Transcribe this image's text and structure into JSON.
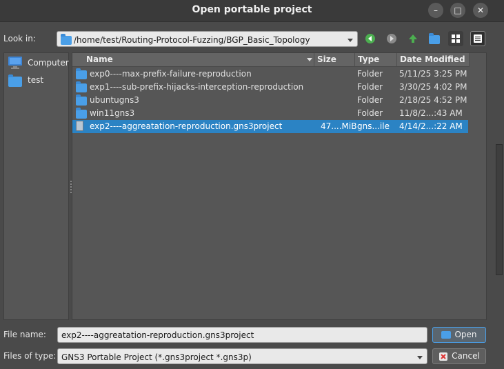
{
  "window": {
    "title": "Open portable project",
    "minimize_glyph": "–",
    "maximize_glyph": "□",
    "close_glyph": "✕"
  },
  "lookin": {
    "label": "Look in:",
    "path": "/home/test/Routing-Protocol-Fuzzing/BGP_Basic_Topology"
  },
  "toolbar": {
    "back_icon": "back-arrow-icon",
    "forward_icon": "forward-arrow-icon",
    "up_icon": "parent-directory-icon",
    "new_folder_icon": "new-folder-icon",
    "list_view_icon": "list-view-icon",
    "detail_view_icon": "detail-view-icon"
  },
  "sidebar": {
    "items": [
      {
        "label": "Computer",
        "icon": "computer-icon"
      },
      {
        "label": "test",
        "icon": "folder-icon"
      }
    ]
  },
  "columns": {
    "name": "Name",
    "size": "Size",
    "type": "Type",
    "date": "Date Modified"
  },
  "files": [
    {
      "name": "exp0----max-prefix-failure-reproduction",
      "size": "",
      "type": "Folder",
      "date": "5/11/25 3:25 PM",
      "icon": "folder-icon"
    },
    {
      "name": "exp1----sub-prefix-hijacks-interception-reproduction",
      "size": "",
      "type": "Folder",
      "date": "3/30/25 4:02 PM",
      "icon": "folder-icon"
    },
    {
      "name": "ubuntugns3",
      "size": "",
      "type": "Folder",
      "date": "2/18/25 4:52 PM",
      "icon": "folder-icon"
    },
    {
      "name": "win11gns3",
      "size": "",
      "type": "Folder",
      "date": "11/8/2...:43 AM",
      "icon": "folder-icon"
    },
    {
      "name": "exp2----aggreatation-reproduction.gns3project",
      "size": "47....MiB",
      "type": "gns...ile",
      "date": "4/14/2...:22 AM",
      "icon": "file-icon",
      "selected": true
    }
  ],
  "filename": {
    "label": "File name:",
    "value": "exp2----aggreatation-reproduction.gns3project"
  },
  "filetype": {
    "label": "Files of type:",
    "value": "GNS3 Portable Project (*.gns3project *.gns3p)"
  },
  "buttons": {
    "open": "Open",
    "cancel": "Cancel"
  },
  "colors": {
    "selection": "#2b83c4",
    "folder": "#4a9fe8",
    "nav_arrows": "#4caf50"
  }
}
